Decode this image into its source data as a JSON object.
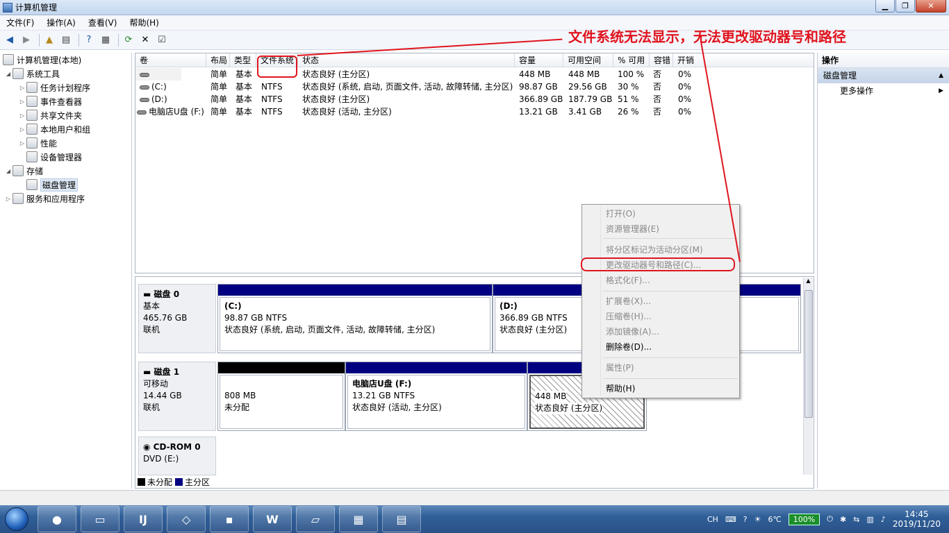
{
  "window": {
    "title": "计算机管理"
  },
  "menu": [
    "文件(F)",
    "操作(A)",
    "查看(V)",
    "帮助(H)"
  ],
  "annotation": "文件系统无法显示，无法更改驱动器号和路径",
  "tree": {
    "root": "计算机管理(本地)",
    "system_tools": "系统工具",
    "task_scheduler": "任务计划程序",
    "event_viewer": "事件查看器",
    "shared_folders": "共享文件夹",
    "local_users": "本地用户和组",
    "performance": "性能",
    "device_manager": "设备管理器",
    "storage": "存储",
    "disk_management": "磁盘管理",
    "services_apps": "服务和应用程序"
  },
  "volume_list": {
    "headers": [
      "卷",
      "布局",
      "类型",
      "文件系统",
      "状态",
      "容量",
      "可用空间",
      "% 可用",
      "容错",
      "开销"
    ],
    "rows": [
      [
        "",
        "简单",
        "基本",
        "",
        "状态良好 (主分区)",
        "448 MB",
        "448 MB",
        "100 %",
        "否",
        "0%"
      ],
      [
        "(C:)",
        "简单",
        "基本",
        "NTFS",
        "状态良好 (系统, 启动, 页面文件, 活动, 故障转储, 主分区)",
        "98.87 GB",
        "29.56 GB",
        "30 %",
        "否",
        "0%"
      ],
      [
        "(D:)",
        "简单",
        "基本",
        "NTFS",
        "状态良好 (主分区)",
        "366.89 GB",
        "187.79 GB",
        "51 %",
        "否",
        "0%"
      ],
      [
        "电脑店U盘 (F:)",
        "简单",
        "基本",
        "NTFS",
        "状态良好 (活动, 主分区)",
        "13.21 GB",
        "3.41 GB",
        "26 %",
        "否",
        "0%"
      ]
    ]
  },
  "disks": {
    "disk0": {
      "name": "磁盘 0",
      "type": "基本",
      "size": "465.76 GB",
      "status": "联机",
      "c": {
        "name": "(C:)",
        "size": "98.87 GB NTFS",
        "status": "状态良好 (系统, 启动, 页面文件, 活动, 故障转储, 主分区)"
      },
      "d": {
        "name": "(D:)",
        "size": "366.89 GB NTFS",
        "status": "状态良好 (主分区)"
      }
    },
    "disk1": {
      "name": "磁盘 1",
      "type": "可移动",
      "size": "14.44 GB",
      "status": "联机",
      "unalloc": {
        "size": "808 MB",
        "status": "未分配"
      },
      "f": {
        "name": "电脑店U盘  (F:)",
        "size": "13.21 GB NTFS",
        "status": "状态良好 (活动, 主分区)"
      },
      "hidden": {
        "size": "448 MB",
        "status": "状态良好 (主分区)"
      }
    },
    "cdrom0": {
      "name": "CD-ROM 0",
      "drive": "DVD (E:)"
    }
  },
  "legend": {
    "unallocated": "未分配",
    "primary": "主分区"
  },
  "context_menu": {
    "open": "打开(O)",
    "explorer": "资源管理器(E)",
    "mark_active": "将分区标记为活动分区(M)",
    "change_letter": "更改驱动器号和路径(C)...",
    "format": "格式化(F)...",
    "extend": "扩展卷(X)...",
    "shrink": "压缩卷(H)...",
    "mirror": "添加镜像(A)...",
    "delete": "删除卷(D)...",
    "properties": "属性(P)",
    "help": "帮助(H)"
  },
  "actions": {
    "title": "操作",
    "section": "磁盘管理",
    "more": "更多操作"
  },
  "taskbar": {
    "lang": "CH",
    "temperature": "6℃",
    "battery": "100%",
    "time": "14:45",
    "date": "2019/11/20"
  },
  "colors": {
    "primary_partition": "#000080",
    "unallocated": "#000000",
    "annotation": "#e0141e"
  }
}
